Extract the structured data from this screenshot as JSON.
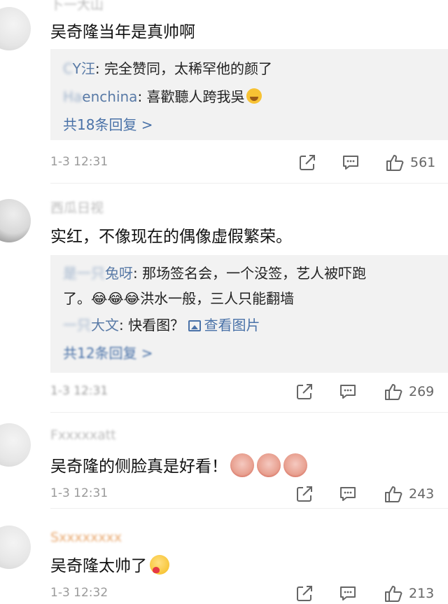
{
  "comments": [
    {
      "username": "卜一大山",
      "text": "吴奇隆当年是真帅啊",
      "replies": [
        {
          "user_blur": "C",
          "user": "Y汪",
          "text": ": 完全赞同，太稀罕他的颜了"
        },
        {
          "user_blur": "Ha",
          "user": "enchina",
          "text": ": 喜歡聽人跨我吳"
        }
      ],
      "more_label": "共18条回复 >",
      "time": "1-3 12:31",
      "likes": "561"
    },
    {
      "username": "西瓜日视",
      "text": "实红，不像现在的偶像虚假繁荣。",
      "replies": [
        {
          "user_blur": "是一只",
          "user": "兔呀",
          "text": ": 那场签名会，一个没签，艺人被吓跑"
        },
        {
          "user_blur": "",
          "user": "",
          "text": "了。😂😂😂洪水一般，三人只能翻墙"
        },
        {
          "user_blur": "一只",
          "user": "大文",
          "text": ": 快看图？",
          "link": "查看图片"
        }
      ],
      "more_label": "共12条回复 >",
      "time": "1-3 12:31",
      "likes": "269"
    },
    {
      "username": "Fxxxxxatt",
      "text": "吴奇隆的侧脸真是好看！",
      "time": "1-3 12:31",
      "likes": "243"
    },
    {
      "username": "Sxxxxxxxx",
      "text": "吴奇隆太帅了",
      "time": "1-3 12:32",
      "likes": "213"
    }
  ],
  "icons": {
    "share": "share-icon",
    "comment": "comment-icon",
    "like": "thumbs-up-icon"
  },
  "colors": {
    "link": "#4a72a8",
    "reply_bg": "#f2f2f2",
    "meta": "#9a9a9a"
  }
}
